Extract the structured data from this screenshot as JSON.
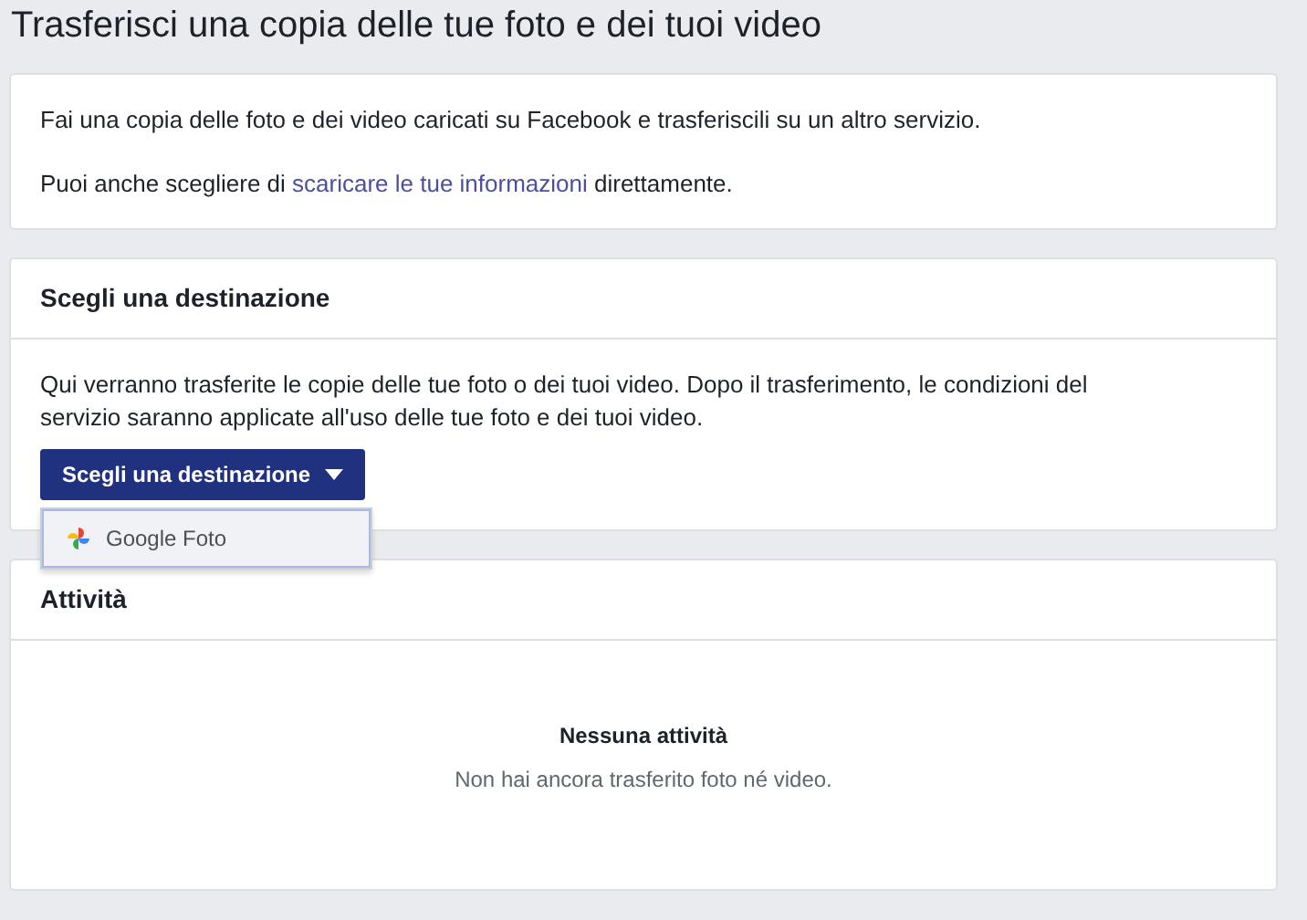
{
  "page_title": "Trasferisci una copia delle tue foto e dei tuoi video",
  "intro": {
    "text": "Fai una copia delle foto e dei video caricati su Facebook e trasferiscili su un altro servizio.",
    "link_before": "Puoi anche scegliere di ",
    "link": "scaricare le tue informazioni",
    "link_after": " direttamente."
  },
  "destination": {
    "title": "Scegli una destinazione",
    "description": "Qui verranno trasferite le copie delle tue foto o dei tuoi video. Dopo il trasferimento, le condizioni del servizio saranno applicate all'uso delle tue foto e dei tuoi video.",
    "button": "Scegli una destinazione",
    "expanded": true,
    "options": [
      {
        "label": "Google Foto",
        "selected": true
      }
    ]
  },
  "activity": {
    "title": "Attività",
    "empty_title": "Nessuna attività",
    "empty_text": "Non hai ancora trasferito foto né video."
  }
}
